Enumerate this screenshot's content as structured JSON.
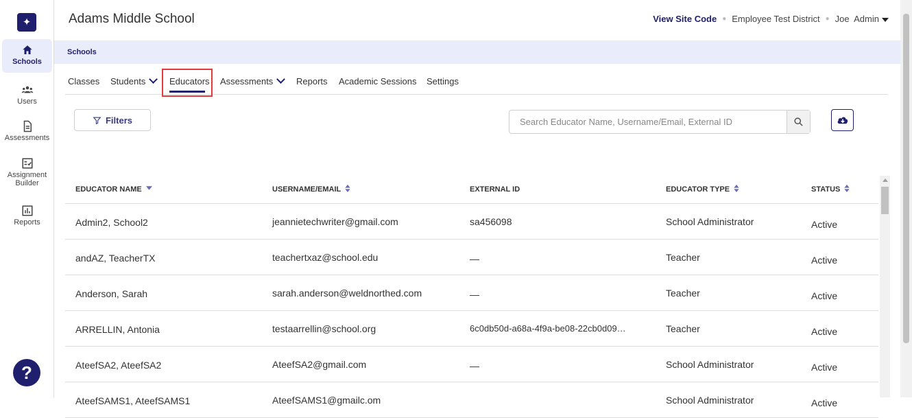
{
  "sidebar": {
    "items": [
      {
        "label": "Schools",
        "icon": "home-icon"
      },
      {
        "label": "Users",
        "icon": "users-icon"
      },
      {
        "label": "Assessments",
        "icon": "document-icon"
      },
      {
        "label": "Assignment Builder",
        "icon": "checklist-icon"
      },
      {
        "label": "Reports",
        "icon": "bar-chart-icon"
      }
    ],
    "help": "?"
  },
  "header": {
    "title": "Adams Middle School",
    "view_site_code": "View Site Code",
    "district": "Employee Test District",
    "user_first": "Joe",
    "user_last": "Admin"
  },
  "breadcrumb": "Schools",
  "tabs": [
    {
      "label": "Classes"
    },
    {
      "label": "Students"
    },
    {
      "label": "Educators"
    },
    {
      "label": "Assessments"
    },
    {
      "label": "Reports"
    },
    {
      "label": "Academic Sessions"
    },
    {
      "label": "Settings"
    }
  ],
  "toolbar": {
    "filters_label": "Filters",
    "search_placeholder": "Search Educator Name, Username/Email, External ID"
  },
  "table": {
    "headers": [
      "EDUCATOR NAME",
      "USERNAME/EMAIL",
      "EXTERNAL ID",
      "EDUCATOR TYPE",
      "STATUS"
    ],
    "rows": [
      {
        "name": "Admin2, School2",
        "email": "jeannietechwriter@gmail.com",
        "external_id": "sa456098",
        "type": "School Administrator",
        "status": "Active"
      },
      {
        "name": "andAZ, TeacherTX",
        "email": "teachertxaz@school.edu",
        "external_id": "—",
        "type": "Teacher",
        "status": "Active"
      },
      {
        "name": "Anderson, Sarah",
        "email": "sarah.anderson@weldnorthed.com",
        "external_id": "—",
        "type": "Teacher",
        "status": "Active"
      },
      {
        "name": "ARRELLIN, Antonia",
        "email": "testaarrellin@school.org",
        "external_id": "6c0db50d-a68a-4f9a-be08-22cb0d09…",
        "type": "Teacher",
        "status": "Active"
      },
      {
        "name": "AteefSA2, AteefSA2",
        "email": "AteefSA2@gmail.com",
        "external_id": "—",
        "type": "School Administrator",
        "status": "Active"
      },
      {
        "name": "AteefSAMS1, AteefSAMS1",
        "email": "AteefSAMS1@gmailc.om",
        "external_id": "",
        "type": "School Administrator",
        "status": "Active"
      }
    ]
  },
  "colors": {
    "brand": "#1f1f6e",
    "highlight": "#e23b3b",
    "crumb_bg": "#e8ecfb"
  }
}
